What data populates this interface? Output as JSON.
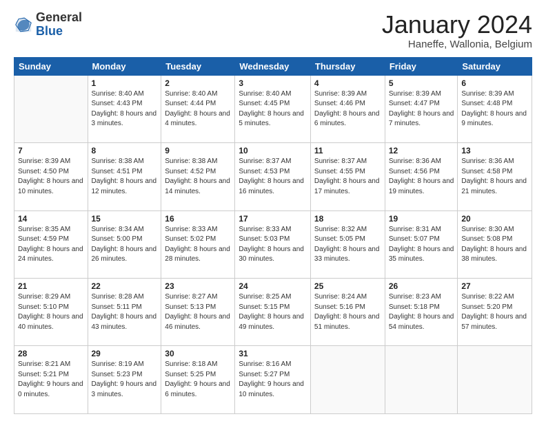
{
  "logo": {
    "text_general": "General",
    "text_blue": "Blue"
  },
  "header": {
    "month_title": "January 2024",
    "location": "Haneffe, Wallonia, Belgium"
  },
  "weekdays": [
    "Sunday",
    "Monday",
    "Tuesday",
    "Wednesday",
    "Thursday",
    "Friday",
    "Saturday"
  ],
  "weeks": [
    [
      {
        "day": "",
        "sunrise": "",
        "sunset": "",
        "daylight": "",
        "empty": true
      },
      {
        "day": "1",
        "sunrise": "Sunrise: 8:40 AM",
        "sunset": "Sunset: 4:43 PM",
        "daylight": "Daylight: 8 hours and 3 minutes.",
        "empty": false
      },
      {
        "day": "2",
        "sunrise": "Sunrise: 8:40 AM",
        "sunset": "Sunset: 4:44 PM",
        "daylight": "Daylight: 8 hours and 4 minutes.",
        "empty": false
      },
      {
        "day": "3",
        "sunrise": "Sunrise: 8:40 AM",
        "sunset": "Sunset: 4:45 PM",
        "daylight": "Daylight: 8 hours and 5 minutes.",
        "empty": false
      },
      {
        "day": "4",
        "sunrise": "Sunrise: 8:39 AM",
        "sunset": "Sunset: 4:46 PM",
        "daylight": "Daylight: 8 hours and 6 minutes.",
        "empty": false
      },
      {
        "day": "5",
        "sunrise": "Sunrise: 8:39 AM",
        "sunset": "Sunset: 4:47 PM",
        "daylight": "Daylight: 8 hours and 7 minutes.",
        "empty": false
      },
      {
        "day": "6",
        "sunrise": "Sunrise: 8:39 AM",
        "sunset": "Sunset: 4:48 PM",
        "daylight": "Daylight: 8 hours and 9 minutes.",
        "empty": false
      }
    ],
    [
      {
        "day": "7",
        "sunrise": "Sunrise: 8:39 AM",
        "sunset": "Sunset: 4:50 PM",
        "daylight": "Daylight: 8 hours and 10 minutes.",
        "empty": false
      },
      {
        "day": "8",
        "sunrise": "Sunrise: 8:38 AM",
        "sunset": "Sunset: 4:51 PM",
        "daylight": "Daylight: 8 hours and 12 minutes.",
        "empty": false
      },
      {
        "day": "9",
        "sunrise": "Sunrise: 8:38 AM",
        "sunset": "Sunset: 4:52 PM",
        "daylight": "Daylight: 8 hours and 14 minutes.",
        "empty": false
      },
      {
        "day": "10",
        "sunrise": "Sunrise: 8:37 AM",
        "sunset": "Sunset: 4:53 PM",
        "daylight": "Daylight: 8 hours and 16 minutes.",
        "empty": false
      },
      {
        "day": "11",
        "sunrise": "Sunrise: 8:37 AM",
        "sunset": "Sunset: 4:55 PM",
        "daylight": "Daylight: 8 hours and 17 minutes.",
        "empty": false
      },
      {
        "day": "12",
        "sunrise": "Sunrise: 8:36 AM",
        "sunset": "Sunset: 4:56 PM",
        "daylight": "Daylight: 8 hours and 19 minutes.",
        "empty": false
      },
      {
        "day": "13",
        "sunrise": "Sunrise: 8:36 AM",
        "sunset": "Sunset: 4:58 PM",
        "daylight": "Daylight: 8 hours and 21 minutes.",
        "empty": false
      }
    ],
    [
      {
        "day": "14",
        "sunrise": "Sunrise: 8:35 AM",
        "sunset": "Sunset: 4:59 PM",
        "daylight": "Daylight: 8 hours and 24 minutes.",
        "empty": false
      },
      {
        "day": "15",
        "sunrise": "Sunrise: 8:34 AM",
        "sunset": "Sunset: 5:00 PM",
        "daylight": "Daylight: 8 hours and 26 minutes.",
        "empty": false
      },
      {
        "day": "16",
        "sunrise": "Sunrise: 8:33 AM",
        "sunset": "Sunset: 5:02 PM",
        "daylight": "Daylight: 8 hours and 28 minutes.",
        "empty": false
      },
      {
        "day": "17",
        "sunrise": "Sunrise: 8:33 AM",
        "sunset": "Sunset: 5:03 PM",
        "daylight": "Daylight: 8 hours and 30 minutes.",
        "empty": false
      },
      {
        "day": "18",
        "sunrise": "Sunrise: 8:32 AM",
        "sunset": "Sunset: 5:05 PM",
        "daylight": "Daylight: 8 hours and 33 minutes.",
        "empty": false
      },
      {
        "day": "19",
        "sunrise": "Sunrise: 8:31 AM",
        "sunset": "Sunset: 5:07 PM",
        "daylight": "Daylight: 8 hours and 35 minutes.",
        "empty": false
      },
      {
        "day": "20",
        "sunrise": "Sunrise: 8:30 AM",
        "sunset": "Sunset: 5:08 PM",
        "daylight": "Daylight: 8 hours and 38 minutes.",
        "empty": false
      }
    ],
    [
      {
        "day": "21",
        "sunrise": "Sunrise: 8:29 AM",
        "sunset": "Sunset: 5:10 PM",
        "daylight": "Daylight: 8 hours and 40 minutes.",
        "empty": false
      },
      {
        "day": "22",
        "sunrise": "Sunrise: 8:28 AM",
        "sunset": "Sunset: 5:11 PM",
        "daylight": "Daylight: 8 hours and 43 minutes.",
        "empty": false
      },
      {
        "day": "23",
        "sunrise": "Sunrise: 8:27 AM",
        "sunset": "Sunset: 5:13 PM",
        "daylight": "Daylight: 8 hours and 46 minutes.",
        "empty": false
      },
      {
        "day": "24",
        "sunrise": "Sunrise: 8:25 AM",
        "sunset": "Sunset: 5:15 PM",
        "daylight": "Daylight: 8 hours and 49 minutes.",
        "empty": false
      },
      {
        "day": "25",
        "sunrise": "Sunrise: 8:24 AM",
        "sunset": "Sunset: 5:16 PM",
        "daylight": "Daylight: 8 hours and 51 minutes.",
        "empty": false
      },
      {
        "day": "26",
        "sunrise": "Sunrise: 8:23 AM",
        "sunset": "Sunset: 5:18 PM",
        "daylight": "Daylight: 8 hours and 54 minutes.",
        "empty": false
      },
      {
        "day": "27",
        "sunrise": "Sunrise: 8:22 AM",
        "sunset": "Sunset: 5:20 PM",
        "daylight": "Daylight: 8 hours and 57 minutes.",
        "empty": false
      }
    ],
    [
      {
        "day": "28",
        "sunrise": "Sunrise: 8:21 AM",
        "sunset": "Sunset: 5:21 PM",
        "daylight": "Daylight: 9 hours and 0 minutes.",
        "empty": false
      },
      {
        "day": "29",
        "sunrise": "Sunrise: 8:19 AM",
        "sunset": "Sunset: 5:23 PM",
        "daylight": "Daylight: 9 hours and 3 minutes.",
        "empty": false
      },
      {
        "day": "30",
        "sunrise": "Sunrise: 8:18 AM",
        "sunset": "Sunset: 5:25 PM",
        "daylight": "Daylight: 9 hours and 6 minutes.",
        "empty": false
      },
      {
        "day": "31",
        "sunrise": "Sunrise: 8:16 AM",
        "sunset": "Sunset: 5:27 PM",
        "daylight": "Daylight: 9 hours and 10 minutes.",
        "empty": false
      },
      {
        "day": "",
        "sunrise": "",
        "sunset": "",
        "daylight": "",
        "empty": true
      },
      {
        "day": "",
        "sunrise": "",
        "sunset": "",
        "daylight": "",
        "empty": true
      },
      {
        "day": "",
        "sunrise": "",
        "sunset": "",
        "daylight": "",
        "empty": true
      }
    ]
  ]
}
